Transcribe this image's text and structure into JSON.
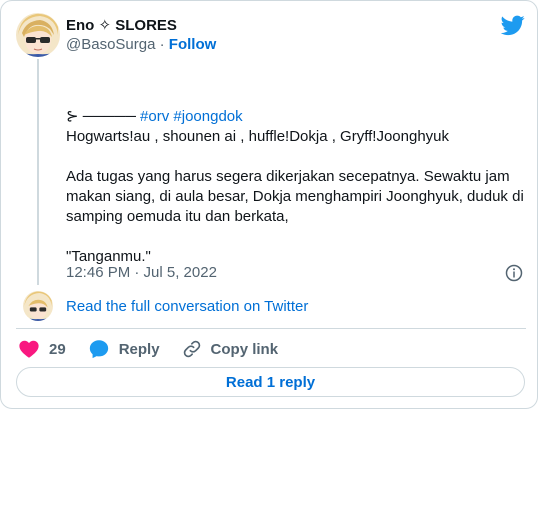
{
  "author": {
    "name": "Eno ✧ SLORES",
    "handle": "@BasoSurga",
    "separator": " · ",
    "follow_label": "Follow"
  },
  "tweet": {
    "line1_prefix": "⊱ ───── ",
    "line1_hashtags": "#orv #joongdok",
    "line2": "Hogwarts!au , shounen ai , huffle!Dokja , Gryff!Joonghyuk",
    "para2": "Ada tugas yang harus segera dikerjakan secepatnya. Sewaktu jam makan siang, di aula besar, Dokja menghampiri Joonghyuk, duduk di samping oemuda itu dan berkata,",
    "para3": "\"Tanganmu.\""
  },
  "timestamp": "12:46 PM · Jul 5, 2022",
  "read_full_label": "Read the full conversation on Twitter",
  "actions": {
    "likes_count": "29",
    "reply_label": "Reply",
    "copy_link_label": "Copy link"
  },
  "read_replies_label": "Read 1 reply",
  "icons": {
    "brand": "twitter-bird-icon",
    "like": "heart-icon",
    "reply": "speech-bubble-icon",
    "copy": "link-icon",
    "info": "info-icon"
  },
  "colors": {
    "link": "#006fd6",
    "twitter_blue": "#1d9bf0",
    "like": "#f91880",
    "muted": "#536471",
    "border": "#cfd9de"
  }
}
